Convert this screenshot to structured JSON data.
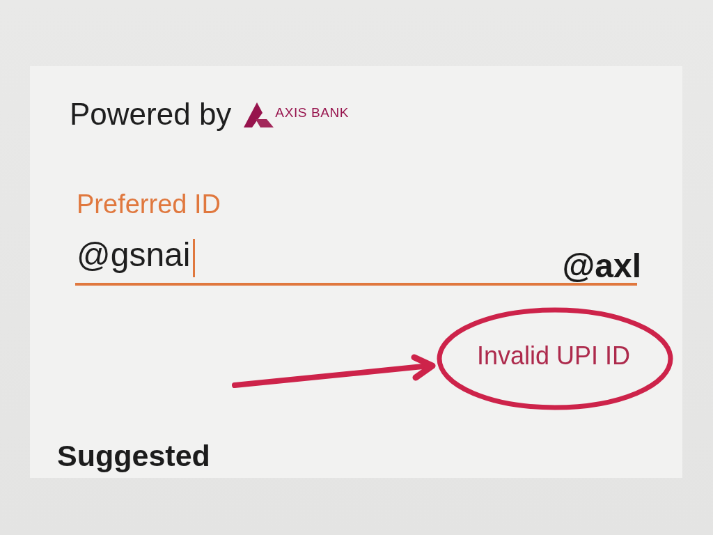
{
  "header": {
    "powered_by": "Powered by",
    "bank_name": "AXIS BANK"
  },
  "field": {
    "label": "Preferred ID",
    "value": "@gsnai",
    "suffix": "@axl",
    "focused": true,
    "error": "Invalid UPI ID"
  },
  "section_title": "Suggested"
}
